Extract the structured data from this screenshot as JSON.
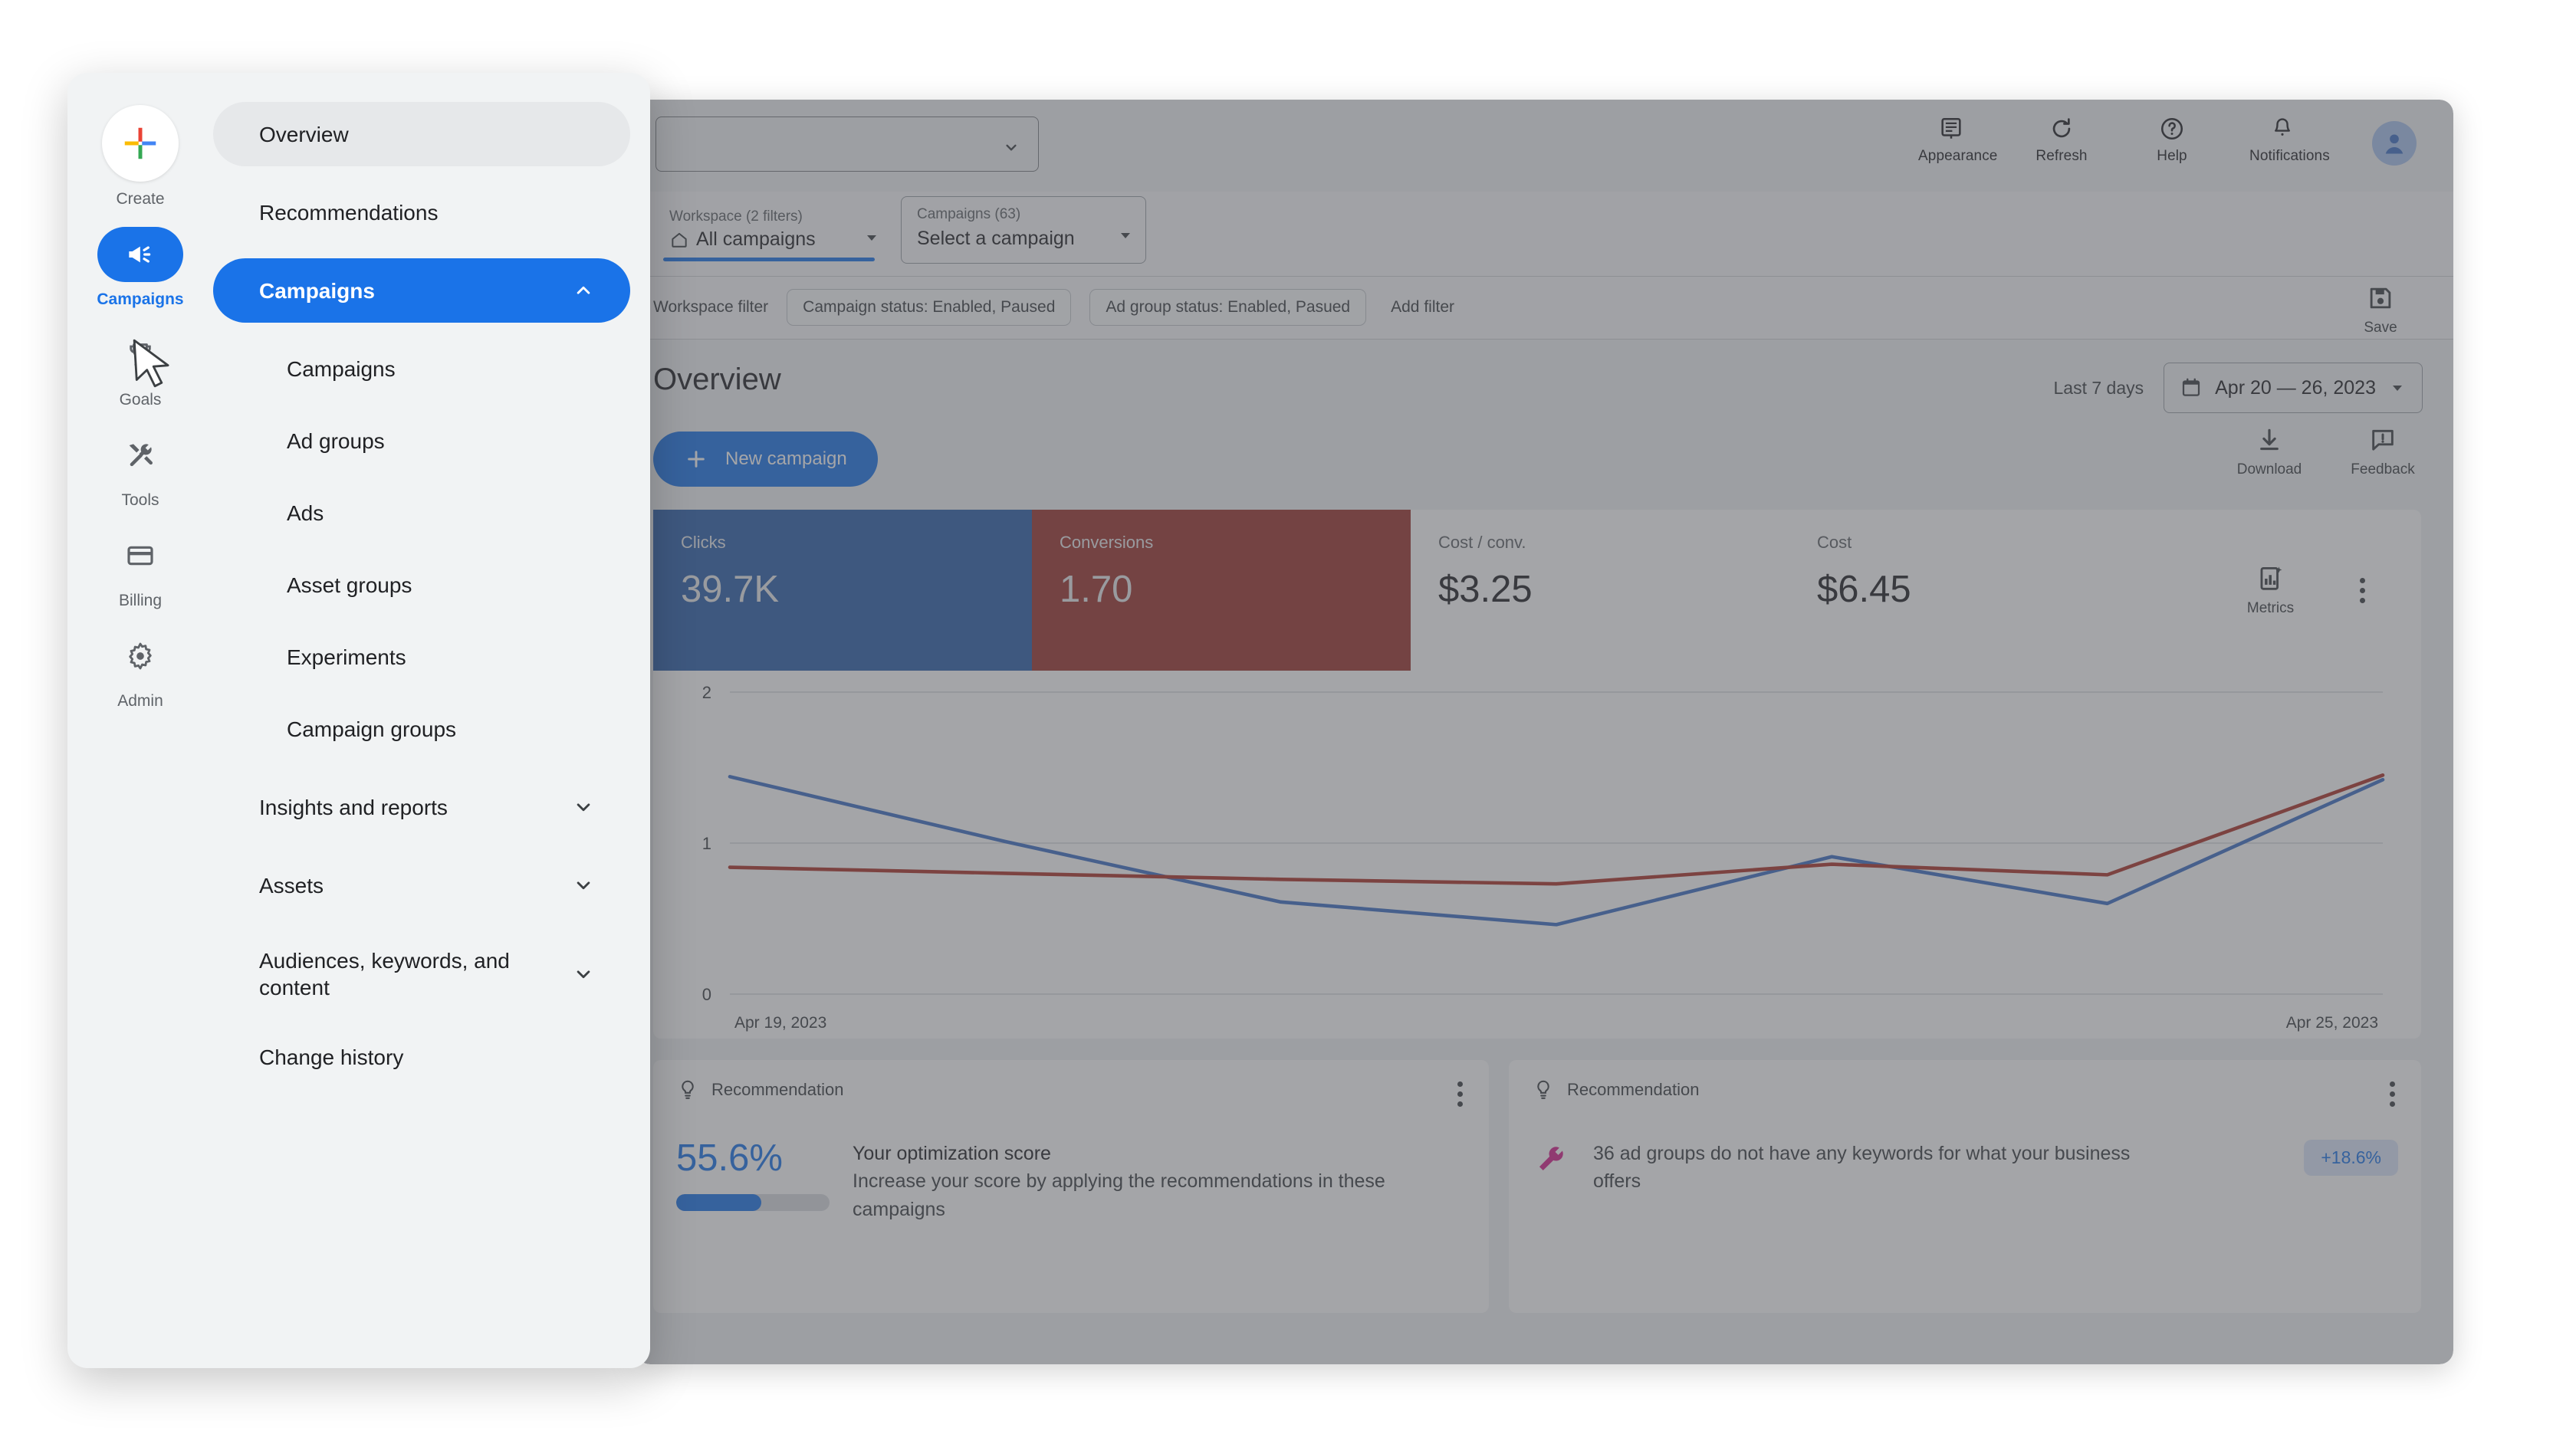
{
  "nav_rail": {
    "items": [
      {
        "label": "Create",
        "icon": "plus-icon",
        "active": false
      },
      {
        "label": "Campaigns",
        "icon": "megaphone-icon",
        "active": true
      },
      {
        "label": "Goals",
        "icon": "trophy-icon",
        "active": false
      },
      {
        "label": "Tools",
        "icon": "tools-icon",
        "active": false
      },
      {
        "label": "Billing",
        "icon": "credit-card-icon",
        "active": false
      },
      {
        "label": "Admin",
        "icon": "gear-icon",
        "active": false
      }
    ]
  },
  "nav_menu": {
    "items": [
      {
        "label": "Overview",
        "state": "highlighted",
        "level": "top",
        "chevron": ""
      },
      {
        "label": "Recommendations",
        "state": "normal",
        "level": "top",
        "chevron": ""
      },
      {
        "label": "Campaigns",
        "state": "selected",
        "level": "top",
        "chevron": "up"
      },
      {
        "label": "Campaigns",
        "state": "normal",
        "level": "sub",
        "chevron": ""
      },
      {
        "label": "Ad groups",
        "state": "normal",
        "level": "sub",
        "chevron": ""
      },
      {
        "label": "Ads",
        "state": "normal",
        "level": "sub",
        "chevron": ""
      },
      {
        "label": "Asset groups",
        "state": "normal",
        "level": "sub",
        "chevron": ""
      },
      {
        "label": "Experiments",
        "state": "normal",
        "level": "sub",
        "chevron": ""
      },
      {
        "label": "Campaign groups",
        "state": "normal",
        "level": "sub",
        "chevron": ""
      },
      {
        "label": "Insights and reports",
        "state": "normal",
        "level": "top",
        "chevron": "down"
      },
      {
        "label": "Assets",
        "state": "normal",
        "level": "top",
        "chevron": "down"
      },
      {
        "label": "Audiences, keywords, and content",
        "state": "normal",
        "level": "top",
        "chevron": "down"
      },
      {
        "label": "Change history",
        "state": "normal",
        "level": "top",
        "chevron": ""
      }
    ]
  },
  "topbar": {
    "account_selector_value": "",
    "icons": [
      {
        "label": "Appearance",
        "icon": "appearance-icon"
      },
      {
        "label": "Refresh",
        "icon": "refresh-icon"
      },
      {
        "label": "Help",
        "icon": "help-icon"
      },
      {
        "label": "Notifications",
        "icon": "bell-icon"
      }
    ],
    "avatar": "account-avatar"
  },
  "selectors": {
    "workspace_caption": "Workspace (2 filters)",
    "workspace_value": "All campaigns",
    "campaigns_caption": "Campaigns (63)",
    "campaigns_value": "Select a campaign"
  },
  "filters": {
    "label": "Workspace filter",
    "chips": [
      "Campaign status: Enabled, Paused",
      "Ad group status: Enabled, Pasued"
    ],
    "add_filter": "Add filter",
    "save_label": "Save"
  },
  "page": {
    "title": "Overview",
    "date_preset": "Last 7 days",
    "date_range": "Apr 20 — 26, 2023",
    "new_campaign": "New campaign",
    "download_label": "Download",
    "feedback_label": "Feedback"
  },
  "metrics": {
    "cards": [
      {
        "label": "Clicks",
        "value": "39.7K",
        "style": "selected-blue"
      },
      {
        "label": "Conversions",
        "value": "1.70",
        "style": "selected-red"
      },
      {
        "label": "Cost / conv.",
        "value": "$3.25",
        "style": "plain"
      },
      {
        "label": "Cost",
        "value": "$6.45",
        "style": "plain"
      }
    ],
    "metrics_button": "Metrics"
  },
  "chart_data": {
    "type": "line",
    "title": "",
    "xlabel": "",
    "ylabel": "",
    "ylim": [
      0,
      2
    ],
    "yticks": [
      0,
      1,
      2
    ],
    "grid": true,
    "legend": "none",
    "x": [
      "Apr 19, 2023",
      "Apr 20, 2023",
      "Apr 21, 2023",
      "Apr 22, 2023",
      "Apr 23, 2023",
      "Apr 24, 2023",
      "Apr 25, 2023"
    ],
    "xtick_labels_shown": [
      "Apr 19, 2023",
      "Apr 25, 2023"
    ],
    "series": [
      {
        "name": "Clicks",
        "color": "#3d6fc4",
        "values": [
          1.44,
          1.01,
          0.61,
          0.46,
          0.91,
          0.6,
          1.42
        ]
      },
      {
        "name": "Conversions",
        "color": "#ab3229",
        "values": [
          0.84,
          0.8,
          0.76,
          0.73,
          0.86,
          0.79,
          1.45
        ]
      }
    ]
  },
  "recommendations": [
    {
      "header": "Recommendation",
      "score": "55.6%",
      "score_percent": 55.6,
      "title": "Your optimization score",
      "body": "Increase your score by applying the recommendations in these campaigns"
    },
    {
      "header": "Recommendation",
      "icon": "keyword-wrench-icon",
      "body": "36 ad groups do not have any keywords for what your business offers",
      "uplift": "+18.6%"
    }
  ],
  "colors": {
    "accent": "#1a73e8",
    "clicks_series": "#3d6fc4",
    "conversions_series": "#ab3229",
    "clicks_card": "#2a5eaa",
    "conversions_card": "#9c322c"
  }
}
